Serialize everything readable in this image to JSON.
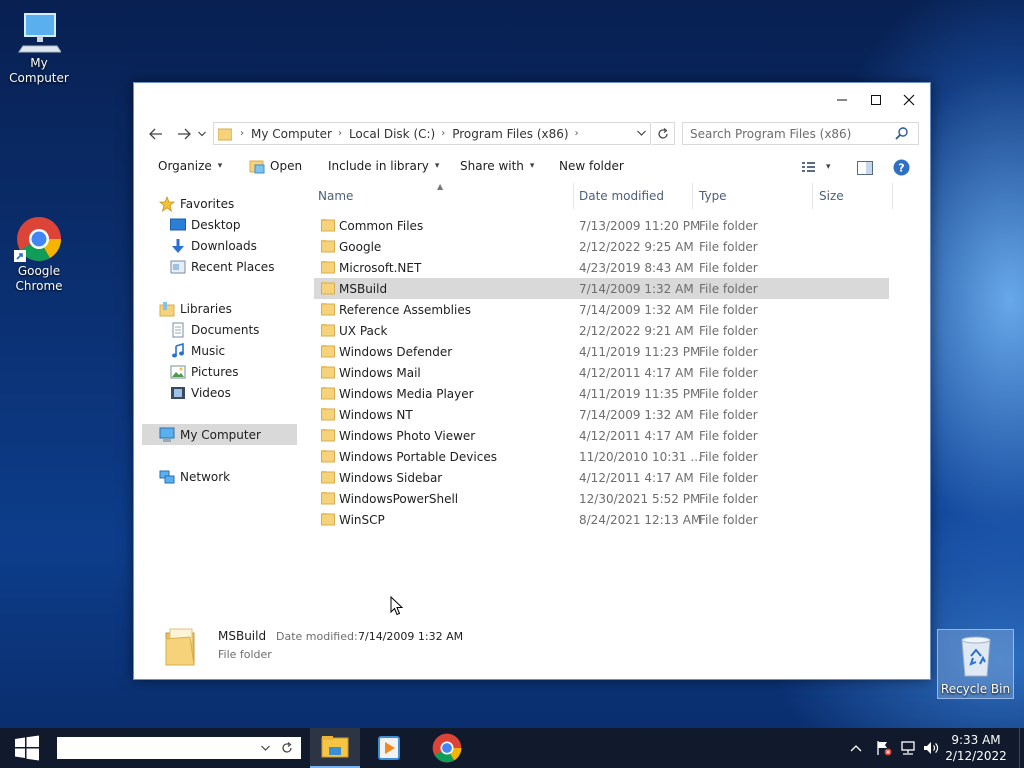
{
  "desktop": {
    "icons": [
      {
        "label": "My Computer"
      },
      {
        "label": "Google Chrome"
      }
    ],
    "recycle_bin": "Recycle Bin"
  },
  "window": {
    "address": {
      "crumbs": [
        "My Computer",
        "Local Disk (C:)",
        "Program Files (x86)"
      ]
    },
    "search_placeholder": "Search Program Files (x86)",
    "toolbar": {
      "organize": "Organize",
      "open": "Open",
      "include_in_library": "Include in library",
      "share_with": "Share with",
      "new_folder": "New folder"
    },
    "nav": {
      "favorites": "Favorites",
      "desktop": "Desktop",
      "downloads": "Downloads",
      "recent_places": "Recent Places",
      "libraries": "Libraries",
      "documents": "Documents",
      "music": "Music",
      "pictures": "Pictures",
      "videos": "Videos",
      "my_computer": "My Computer",
      "network": "Network"
    },
    "columns": {
      "name": "Name",
      "date": "Date modified",
      "type": "Type",
      "size": "Size"
    },
    "files": [
      {
        "name": "Common Files",
        "date": "7/13/2009 11:20 PM",
        "type": "File folder"
      },
      {
        "name": "Google",
        "date": "2/12/2022 9:25 AM",
        "type": "File folder"
      },
      {
        "name": "Microsoft.NET",
        "date": "4/23/2019 8:43 AM",
        "type": "File folder"
      },
      {
        "name": "MSBuild",
        "date": "7/14/2009 1:32 AM",
        "type": "File folder"
      },
      {
        "name": "Reference Assemblies",
        "date": "7/14/2009 1:32 AM",
        "type": "File folder"
      },
      {
        "name": "UX Pack",
        "date": "2/12/2022 9:21 AM",
        "type": "File folder"
      },
      {
        "name": "Windows Defender",
        "date": "4/11/2019 11:23 PM",
        "type": "File folder"
      },
      {
        "name": "Windows Mail",
        "date": "4/12/2011 4:17 AM",
        "type": "File folder"
      },
      {
        "name": "Windows Media Player",
        "date": "4/11/2019 11:35 PM",
        "type": "File folder"
      },
      {
        "name": "Windows NT",
        "date": "7/14/2009 1:32 AM",
        "type": "File folder"
      },
      {
        "name": "Windows Photo Viewer",
        "date": "4/12/2011 4:17 AM",
        "type": "File folder"
      },
      {
        "name": "Windows Portable Devices",
        "date": "11/20/2010 10:31 ...",
        "type": "File folder"
      },
      {
        "name": "Windows Sidebar",
        "date": "4/12/2011 4:17 AM",
        "type": "File folder"
      },
      {
        "name": "WindowsPowerShell",
        "date": "12/30/2021 5:52 PM",
        "type": "File folder"
      },
      {
        "name": "WinSCP",
        "date": "8/24/2021 12:13 AM",
        "type": "File folder"
      }
    ],
    "selected_index": 3,
    "details": {
      "name": "MSBuild",
      "date_label": "Date modified:",
      "date": "7/14/2009 1:32 AM",
      "type": "File folder"
    }
  },
  "taskbar": {
    "time": "9:33 AM",
    "date": "2/12/2022"
  },
  "colors": {
    "folder": "#f6d27a",
    "selection": "#d9d9d9",
    "taskbar": "#101a2c"
  }
}
